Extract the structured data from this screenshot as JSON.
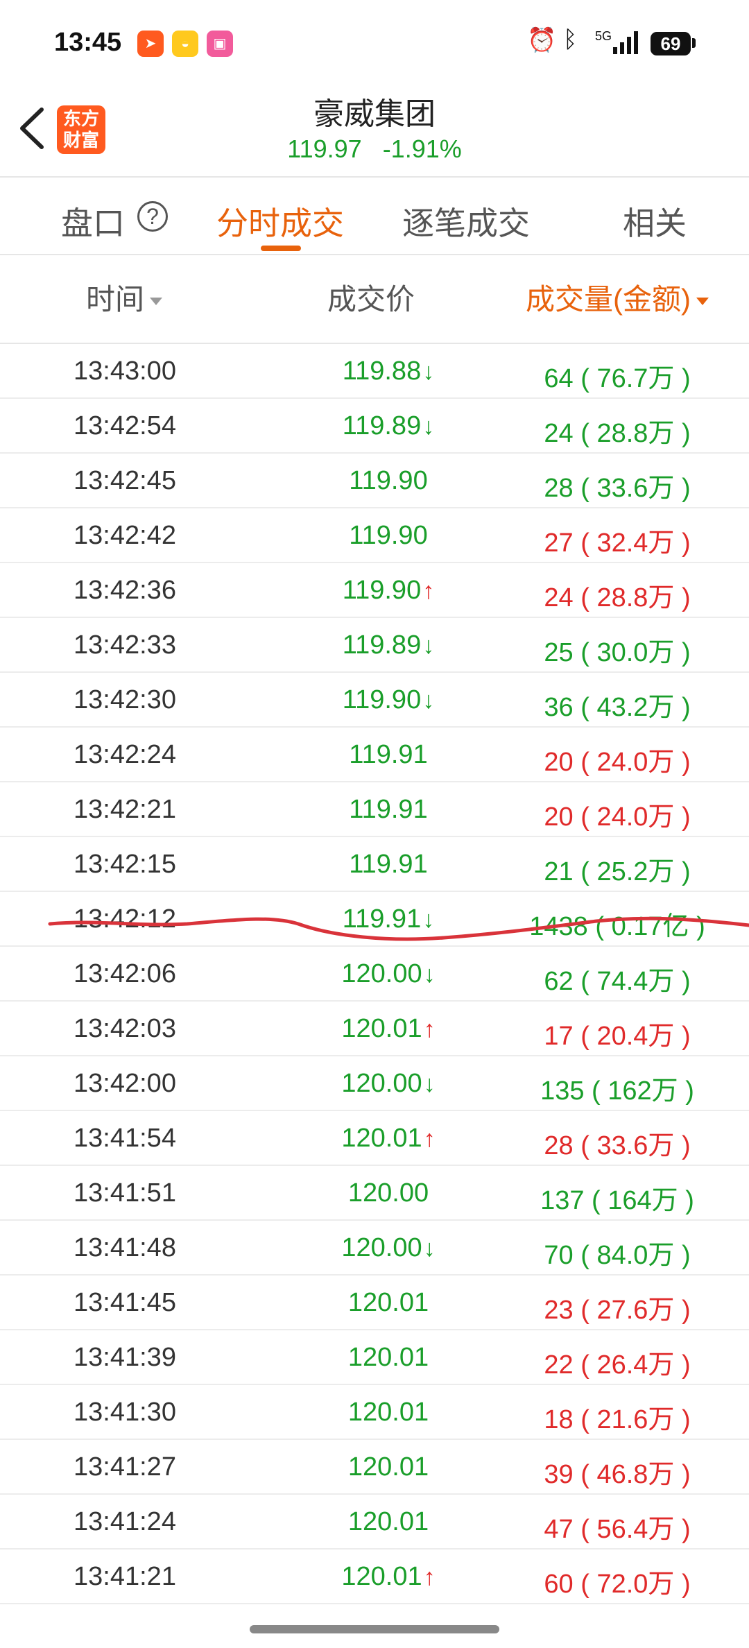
{
  "status_bar": {
    "time": "13:45",
    "battery": "69",
    "network": "5G"
  },
  "header": {
    "logo_text_line1": "东方",
    "logo_text_line2": "财富",
    "title": "豪威集团",
    "price": "119.97",
    "change_pct": "-1.91%"
  },
  "tabs": {
    "t1": "盘口",
    "t2": "分时成交",
    "t3": "逐笔成交",
    "t4": "相关"
  },
  "columns": {
    "time": "时间",
    "price": "成交价",
    "volume": "成交量(金额)"
  },
  "colors": {
    "up": "#e02a2a",
    "down": "#1a9e2a",
    "accent": "#e8620c"
  },
  "trades": [
    {
      "time": "13:43:00",
      "price": "119.88",
      "arrow": "↓",
      "vol": "64",
      "amt": "76.7万",
      "vol_color": "green"
    },
    {
      "time": "13:42:54",
      "price": "119.89",
      "arrow": "↓",
      "vol": "24",
      "amt": "28.8万",
      "vol_color": "green"
    },
    {
      "time": "13:42:45",
      "price": "119.90",
      "arrow": "",
      "vol": "28",
      "amt": "33.6万",
      "vol_color": "green"
    },
    {
      "time": "13:42:42",
      "price": "119.90",
      "arrow": "",
      "vol": "27",
      "amt": "32.4万",
      "vol_color": "red"
    },
    {
      "time": "13:42:36",
      "price": "119.90",
      "arrow": "↑",
      "vol": "24",
      "amt": "28.8万",
      "vol_color": "red"
    },
    {
      "time": "13:42:33",
      "price": "119.89",
      "arrow": "↓",
      "vol": "25",
      "amt": "30.0万",
      "vol_color": "green"
    },
    {
      "time": "13:42:30",
      "price": "119.90",
      "arrow": "↓",
      "vol": "36",
      "amt": "43.2万",
      "vol_color": "green"
    },
    {
      "time": "13:42:24",
      "price": "119.91",
      "arrow": "",
      "vol": "20",
      "amt": "24.0万",
      "vol_color": "red"
    },
    {
      "time": "13:42:21",
      "price": "119.91",
      "arrow": "",
      "vol": "20",
      "amt": "24.0万",
      "vol_color": "red"
    },
    {
      "time": "13:42:15",
      "price": "119.91",
      "arrow": "",
      "vol": "21",
      "amt": "25.2万",
      "vol_color": "green"
    },
    {
      "time": "13:42:12",
      "price": "119.91",
      "arrow": "↓",
      "vol": "1438",
      "amt": "0.17亿",
      "vol_color": "green"
    },
    {
      "time": "13:42:06",
      "price": "120.00",
      "arrow": "↓",
      "vol": "62",
      "amt": "74.4万",
      "vol_color": "green"
    },
    {
      "time": "13:42:03",
      "price": "120.01",
      "arrow": "↑",
      "vol": "17",
      "amt": "20.4万",
      "vol_color": "red"
    },
    {
      "time": "13:42:00",
      "price": "120.00",
      "arrow": "↓",
      "vol": "135",
      "amt": "162万",
      "vol_color": "green"
    },
    {
      "time": "13:41:54",
      "price": "120.01",
      "arrow": "↑",
      "vol": "28",
      "amt": "33.6万",
      "vol_color": "red"
    },
    {
      "time": "13:41:51",
      "price": "120.00",
      "arrow": "",
      "vol": "137",
      "amt": "164万",
      "vol_color": "green"
    },
    {
      "time": "13:41:48",
      "price": "120.00",
      "arrow": "↓",
      "vol": "70",
      "amt": "84.0万",
      "vol_color": "green"
    },
    {
      "time": "13:41:45",
      "price": "120.01",
      "arrow": "",
      "vol": "23",
      "amt": "27.6万",
      "vol_color": "red"
    },
    {
      "time": "13:41:39",
      "price": "120.01",
      "arrow": "",
      "vol": "22",
      "amt": "26.4万",
      "vol_color": "red"
    },
    {
      "time": "13:41:30",
      "price": "120.01",
      "arrow": "",
      "vol": "18",
      "amt": "21.6万",
      "vol_color": "red"
    },
    {
      "time": "13:41:27",
      "price": "120.01",
      "arrow": "",
      "vol": "39",
      "amt": "46.8万",
      "vol_color": "red"
    },
    {
      "time": "13:41:24",
      "price": "120.01",
      "arrow": "",
      "vol": "47",
      "amt": "56.4万",
      "vol_color": "red"
    },
    {
      "time": "13:41:21",
      "price": "120.01",
      "arrow": "↑",
      "vol": "60",
      "amt": "72.0万",
      "vol_color": "red"
    }
  ]
}
